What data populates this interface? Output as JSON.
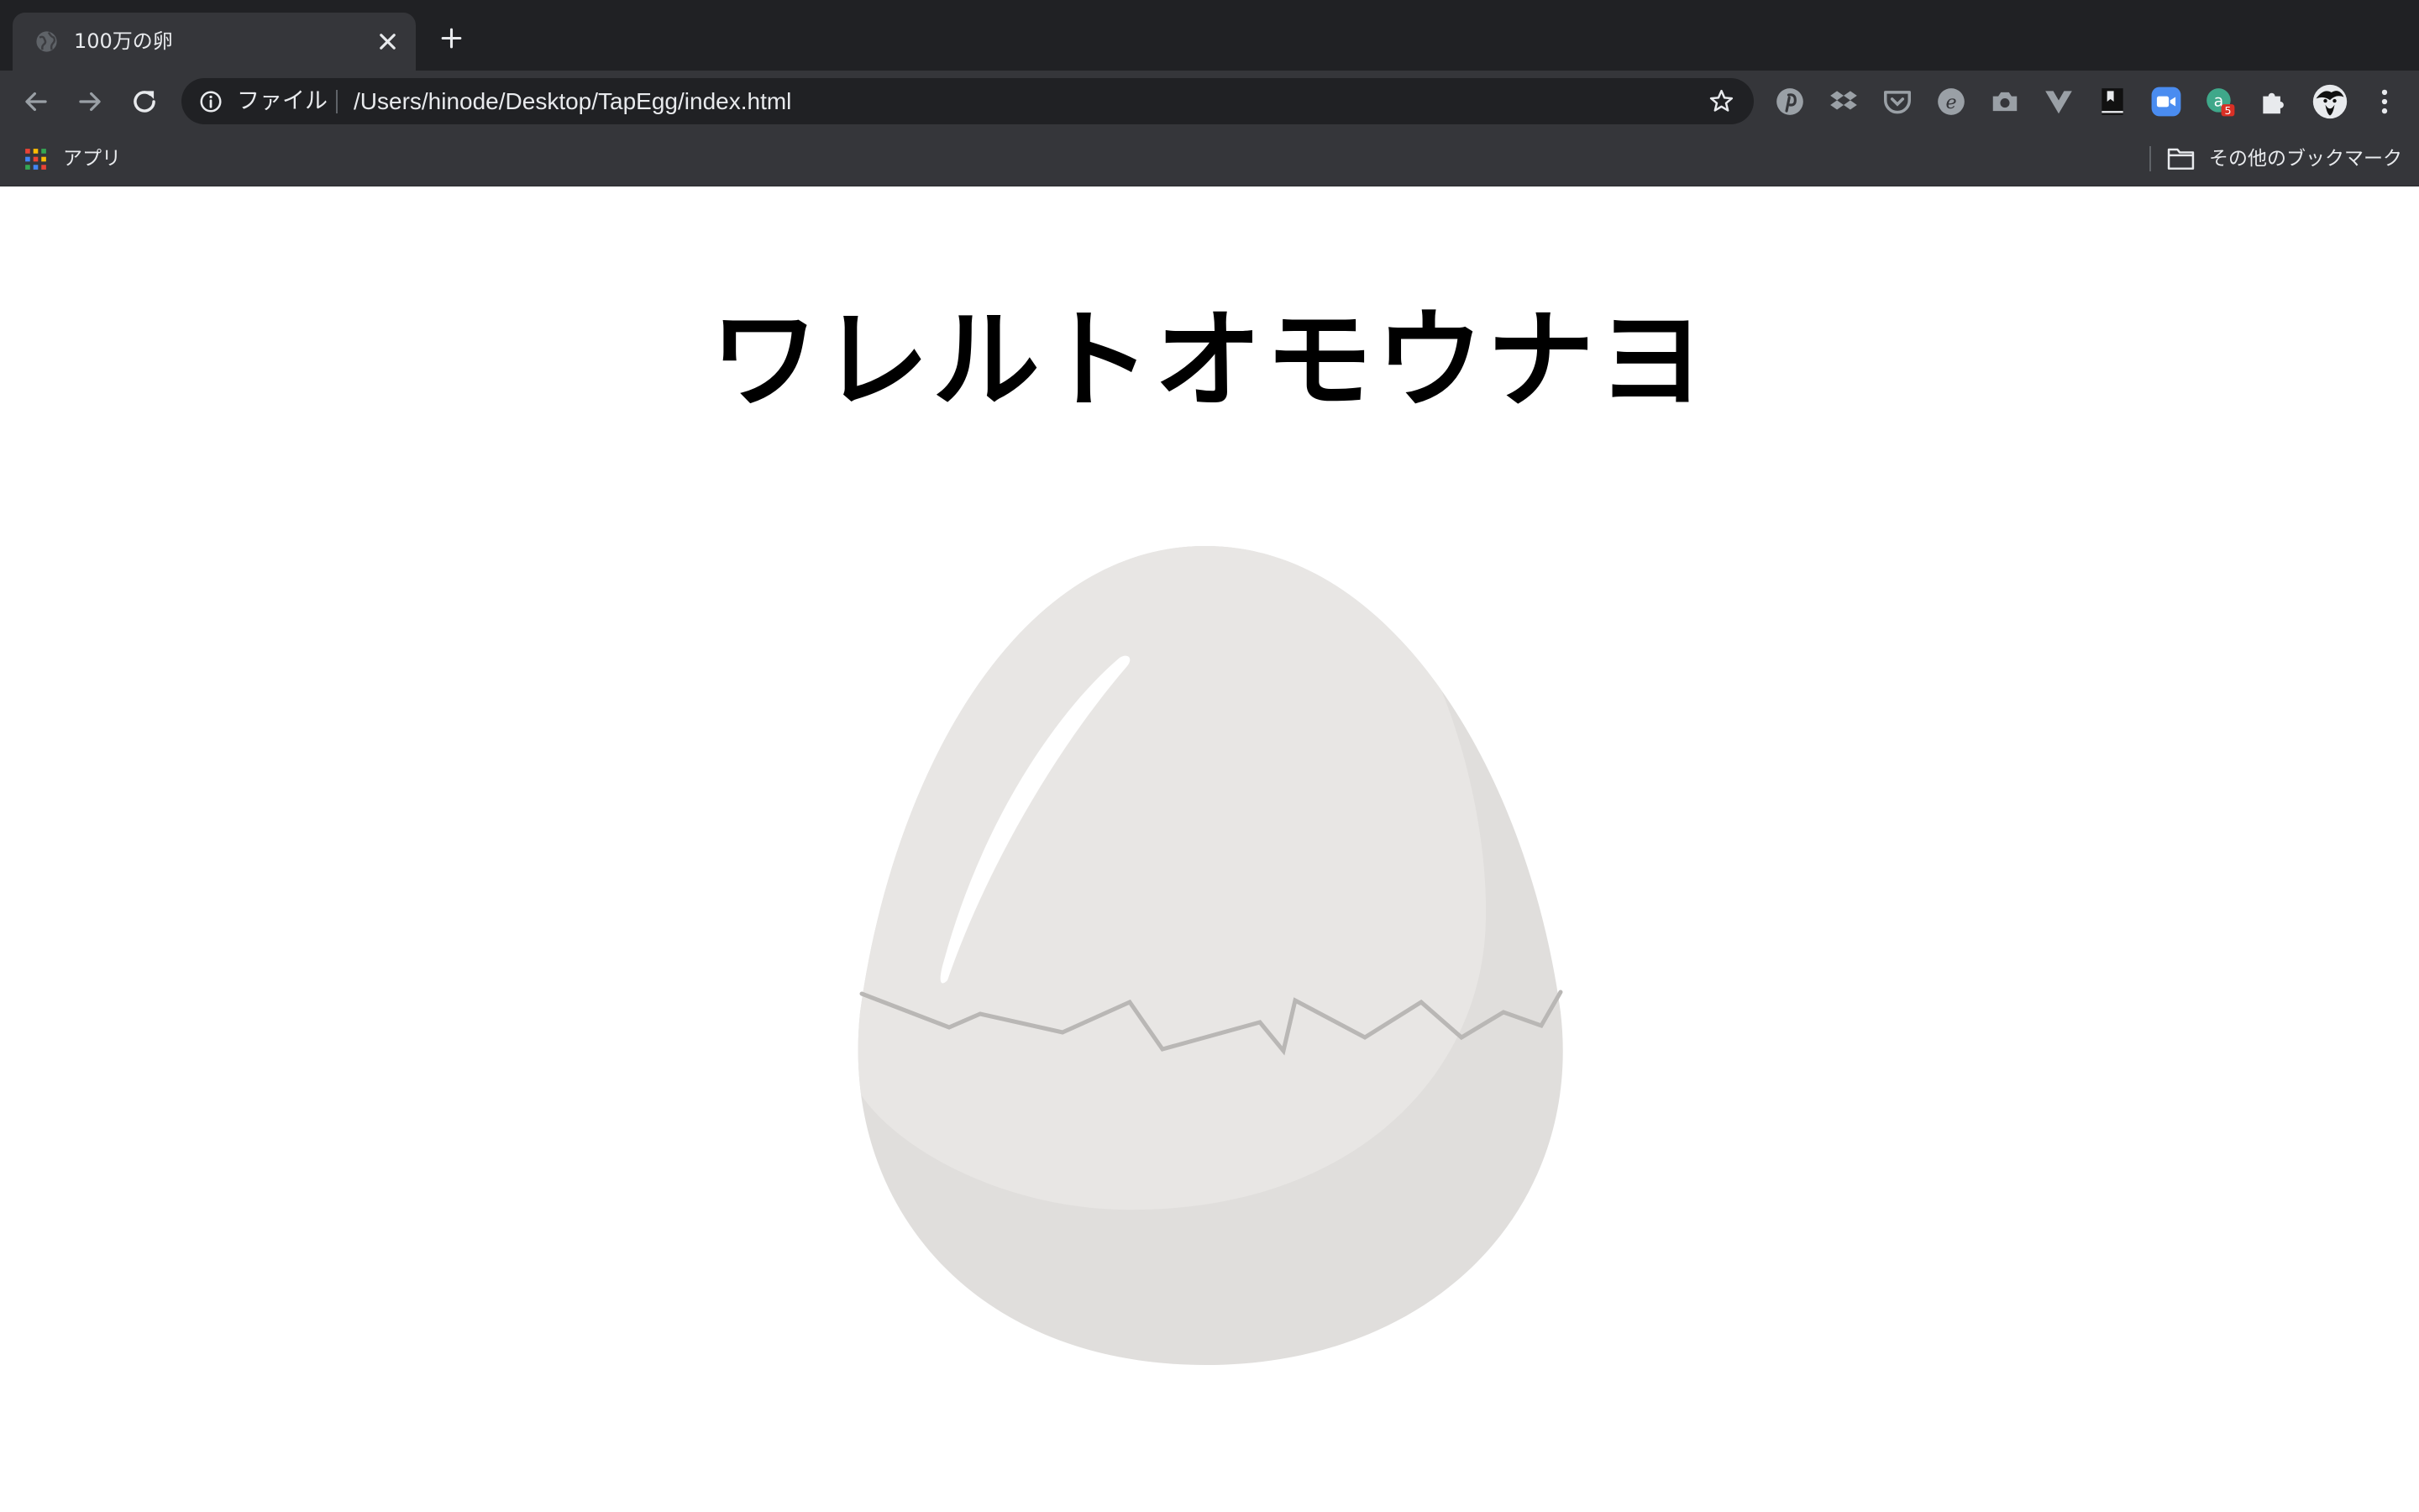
{
  "browser": {
    "tab": {
      "title": "100万の卵"
    },
    "omnibox": {
      "scheme_label": "ファイル",
      "url": "/Users/hinode/Desktop/TapEgg/index.html"
    },
    "extensions": [
      {
        "icon": "pinterest-icon"
      },
      {
        "icon": "dropbox-icon"
      },
      {
        "icon": "pocket-icon"
      },
      {
        "icon": "evernote-icon"
      },
      {
        "icon": "camera-icon"
      },
      {
        "icon": "vue-devtools-icon"
      },
      {
        "icon": "bookmark-icon"
      },
      {
        "icon": "zoom-icon"
      },
      {
        "icon": "extension-badge-icon",
        "badge": "5"
      },
      {
        "icon": "puzzle-icon"
      },
      {
        "icon": "avatar"
      },
      {
        "icon": "kebab-menu-icon"
      }
    ],
    "bookmarks_bar": {
      "apps_label": "アプリ",
      "other_label": "その他のブックマーク"
    }
  },
  "page": {
    "title": "ワレルトオモウナヨ",
    "egg": {
      "icon": "egg-icon"
    }
  },
  "colors": {
    "tabstrip": "#202124",
    "toolbar": "#35363a",
    "egg_shell": "#e8e6e4",
    "egg_shadow": "#dfdddb",
    "crack": "#b9b7b5"
  }
}
